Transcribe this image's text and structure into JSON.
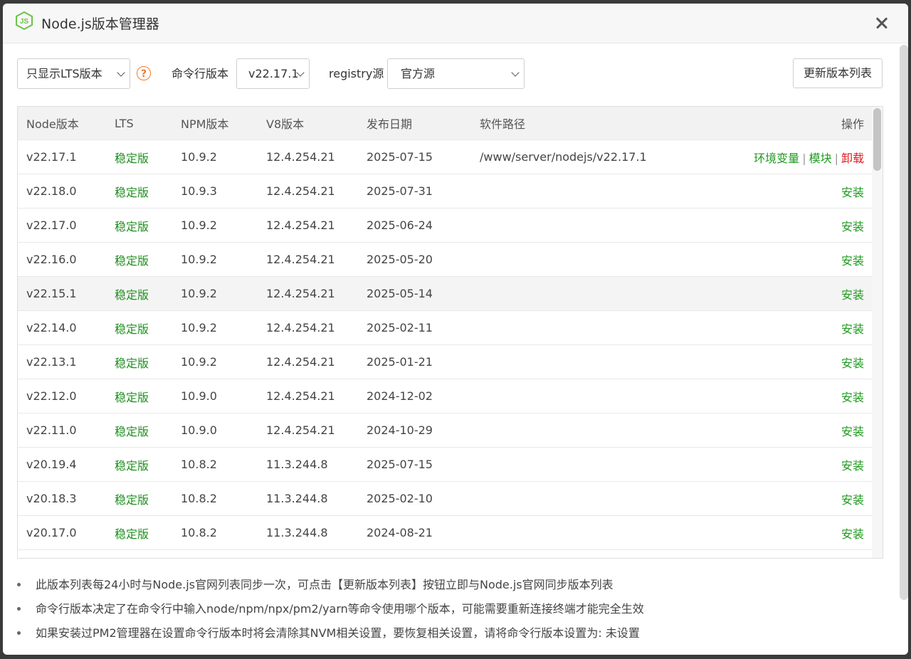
{
  "window": {
    "title": "Node.js版本管理器",
    "icon": "nodejs-icon"
  },
  "toolbar": {
    "filter_value": "只显示LTS版本",
    "help_icon": "?",
    "cli_label": "命令行版本",
    "cli_value": "v22.17.1",
    "registry_label": "registry源",
    "registry_value": "官方源",
    "refresh_label": "更新版本列表"
  },
  "table": {
    "headers": [
      "Node版本",
      "LTS",
      "NPM版本",
      "V8版本",
      "发布日期",
      "软件路径",
      "操作"
    ],
    "rows": [
      {
        "node": "v22.17.1",
        "lts": "稳定版",
        "npm": "10.9.2",
        "v8": "12.4.254.21",
        "date": "2025-07-15",
        "path": "/www/server/nodejs/v22.17.1",
        "installed": true
      },
      {
        "node": "v22.18.0",
        "lts": "稳定版",
        "npm": "10.9.3",
        "v8": "12.4.254.21",
        "date": "2025-07-31",
        "path": "",
        "installed": false
      },
      {
        "node": "v22.17.0",
        "lts": "稳定版",
        "npm": "10.9.2",
        "v8": "12.4.254.21",
        "date": "2025-06-24",
        "path": "",
        "installed": false
      },
      {
        "node": "v22.16.0",
        "lts": "稳定版",
        "npm": "10.9.2",
        "v8": "12.4.254.21",
        "date": "2025-05-20",
        "path": "",
        "installed": false
      },
      {
        "node": "v22.15.1",
        "lts": "稳定版",
        "npm": "10.9.2",
        "v8": "12.4.254.21",
        "date": "2025-05-14",
        "path": "",
        "installed": false
      },
      {
        "node": "v22.14.0",
        "lts": "稳定版",
        "npm": "10.9.2",
        "v8": "12.4.254.21",
        "date": "2025-02-11",
        "path": "",
        "installed": false
      },
      {
        "node": "v22.13.1",
        "lts": "稳定版",
        "npm": "10.9.2",
        "v8": "12.4.254.21",
        "date": "2025-01-21",
        "path": "",
        "installed": false
      },
      {
        "node": "v22.12.0",
        "lts": "稳定版",
        "npm": "10.9.0",
        "v8": "12.4.254.21",
        "date": "2024-12-02",
        "path": "",
        "installed": false
      },
      {
        "node": "v22.11.0",
        "lts": "稳定版",
        "npm": "10.9.0",
        "v8": "12.4.254.21",
        "date": "2024-10-29",
        "path": "",
        "installed": false
      },
      {
        "node": "v20.19.4",
        "lts": "稳定版",
        "npm": "10.8.2",
        "v8": "11.3.244.8",
        "date": "2025-07-15",
        "path": "",
        "installed": false
      },
      {
        "node": "v20.18.3",
        "lts": "稳定版",
        "npm": "10.8.2",
        "v8": "11.3.244.8",
        "date": "2025-02-10",
        "path": "",
        "installed": false
      },
      {
        "node": "v20.17.0",
        "lts": "稳定版",
        "npm": "10.8.2",
        "v8": "11.3.244.8",
        "date": "2024-08-21",
        "path": "",
        "installed": false
      }
    ],
    "actions": {
      "env": "环境变量",
      "modules": "模块",
      "uninstall": "卸载",
      "install": "安装",
      "separator": "|"
    }
  },
  "notes": [
    "此版本列表每24小时与Node.js官网列表同步一次，可点击【更新版本列表】按钮立即与Node.js官网同步版本列表",
    "命令行版本决定了在命令行中输入node/npm/npx/pm2/yarn等命令使用哪个版本，可能需要重新连接终端才能完全生效",
    "如果安装过PM2管理器在设置命令行版本时将会清除其NVM相关设置，要恢复相关设置，请将命令行版本设置为: 未设置"
  ],
  "colors": {
    "lts": "#1f8f1f",
    "action": "#1f9a1f",
    "danger": "#e01b1b",
    "help": "#f07a2a",
    "node_brand": "#6cc24a"
  }
}
